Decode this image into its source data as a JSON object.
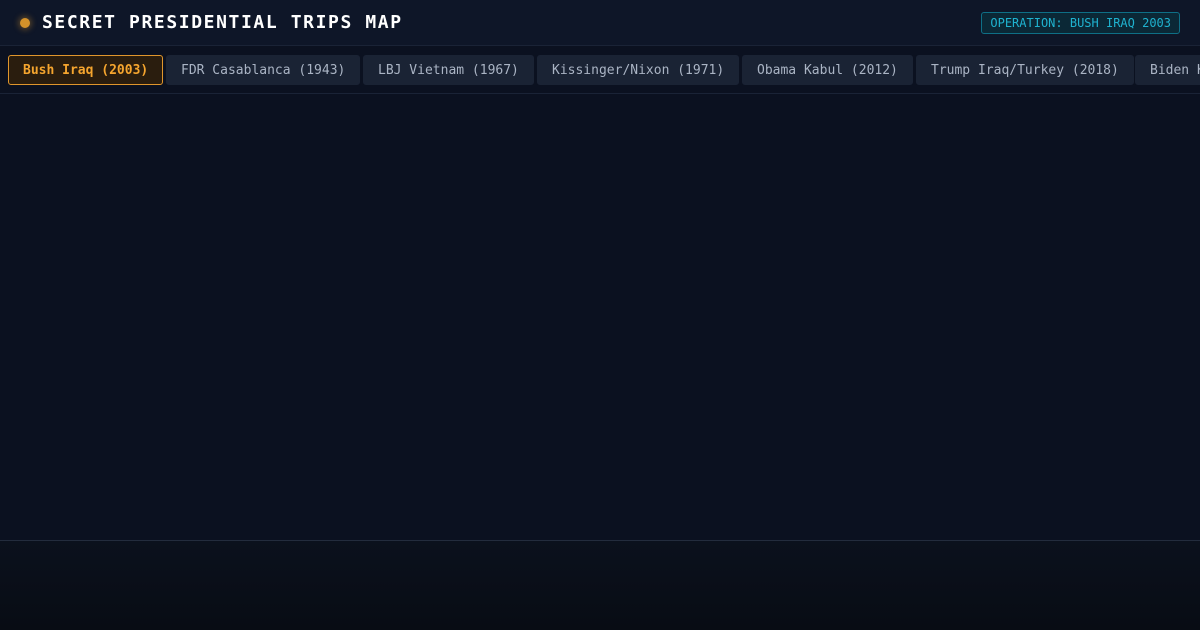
{
  "header": {
    "title": "SECRET PRESIDENTIAL TRIPS MAP",
    "operation_badge": "OPERATION: BUSH IRAQ 2003"
  },
  "colors": {
    "accent": "#e0962c",
    "badge": "#1fb2cf",
    "background": "#0b1120"
  },
  "tabs": [
    {
      "label": "Bush Iraq (2003)",
      "active": true
    },
    {
      "label": "FDR Casablanca (1943)",
      "active": false
    },
    {
      "label": "LBJ Vietnam (1967)",
      "active": false
    },
    {
      "label": "Kissinger/Nixon (1971)",
      "active": false
    },
    {
      "label": "Obama Kabul (2012)",
      "active": false
    },
    {
      "label": "Trump Iraq/Turkey (2018)",
      "active": false
    },
    {
      "label": "Biden K",
      "active": false
    }
  ]
}
